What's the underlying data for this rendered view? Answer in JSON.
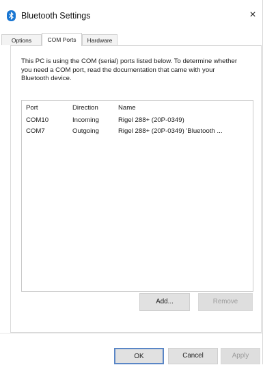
{
  "window": {
    "title": "Bluetooth Settings",
    "close_glyph": "×",
    "icon": "bluetooth-icon"
  },
  "tabs": [
    {
      "label": "Options",
      "active": false
    },
    {
      "label": "COM Ports",
      "active": true
    },
    {
      "label": "Hardware",
      "active": false
    }
  ],
  "description": "This PC is using the COM (serial) ports listed below. To determine whether you need a COM port, read the documentation that came with your Bluetooth device.",
  "ports_table": {
    "columns": [
      "Port",
      "Direction",
      "Name"
    ],
    "rows": [
      {
        "port": "COM10",
        "direction": "Incoming",
        "name": "Rigel 288+ (20P-0349)"
      },
      {
        "port": "COM7",
        "direction": "Outgoing",
        "name": "Rigel 288+ (20P-0349) 'Bluetooth ..."
      }
    ]
  },
  "buttons": {
    "add": "Add...",
    "remove": "Remove",
    "ok": "OK",
    "cancel": "Cancel",
    "apply": "Apply"
  },
  "colors": {
    "bluetooth_blue": "#1976d2",
    "focus_border": "#5a86c6",
    "disabled_text": "#9a9a9a"
  }
}
